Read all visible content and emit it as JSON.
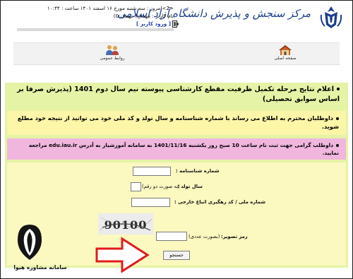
{
  "header": {
    "brand_text": "مرکز سنجش و پذیرش دانشگاه آزاد اسلامی",
    "date_text": "<2>امروز : سه شنبه مورخ ۱۶ اسفند ۱۴۰۱ ساعت : ۱۰:۴۴",
    "user_text": "نام کاربر : مهمان( مهمان 0)",
    "login_label": "[ ورود کاربر ]"
  },
  "nav": {
    "home_label": "صفحه اصلی",
    "relations_label": "روابط عمومی"
  },
  "main": {
    "announcement": "اعلام نتایج مرحله تکمیل ظرفیت مقطع کارشناسی پیوسته نیم سال دوم 1401 (پذیرش صرفا بر اساس سوابق تحصیلی)",
    "notice1": "داوطلبان محترم به اطلاع می رساند با شماره شناسنامه و سال تولد و کد ملی خود می توانید از نتیجه خود مطلع شوید.",
    "notice2": "داوطلب گرامی جهت ثبت نام ساعت 10 صبح روز یکشنبه 1401/11/16 به سامانه آموزشیار به آدرس edu.iau.ir مراجعه نمایید."
  },
  "form": {
    "id_number_label": "شماره شناسنامه :",
    "id_number_value": "",
    "birth_year_label": "سال تولد :",
    "birth_year_placeholder": "(به صورت دو رقم)",
    "birth_year_value": "",
    "national_code_label": "شماره ملی / کد رهگیری اتباع خارجی :",
    "national_code_value": "",
    "captcha_text": "90100",
    "captcha_label": "رمز تصویر:",
    "captcha_hint": "(بصورت عددی)",
    "captcha_value": "",
    "search_label": "جستجو"
  },
  "watermark": {
    "brand_text": "سامانه مشاوره هیوا"
  }
}
